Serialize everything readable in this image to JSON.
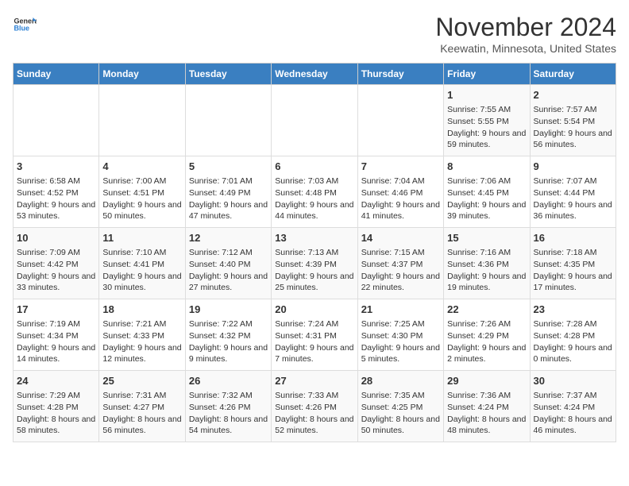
{
  "header": {
    "logo": {
      "line1": "General",
      "line2": "Blue"
    },
    "title": "November 2024",
    "subtitle": "Keewatin, Minnesota, United States"
  },
  "weekdays": [
    "Sunday",
    "Monday",
    "Tuesday",
    "Wednesday",
    "Thursday",
    "Friday",
    "Saturday"
  ],
  "weeks": [
    [
      {
        "day": "",
        "info": ""
      },
      {
        "day": "",
        "info": ""
      },
      {
        "day": "",
        "info": ""
      },
      {
        "day": "",
        "info": ""
      },
      {
        "day": "",
        "info": ""
      },
      {
        "day": "1",
        "info": "Sunrise: 7:55 AM\nSunset: 5:55 PM\nDaylight: 9 hours and 59 minutes."
      },
      {
        "day": "2",
        "info": "Sunrise: 7:57 AM\nSunset: 5:54 PM\nDaylight: 9 hours and 56 minutes."
      }
    ],
    [
      {
        "day": "3",
        "info": "Sunrise: 6:58 AM\nSunset: 4:52 PM\nDaylight: 9 hours and 53 minutes."
      },
      {
        "day": "4",
        "info": "Sunrise: 7:00 AM\nSunset: 4:51 PM\nDaylight: 9 hours and 50 minutes."
      },
      {
        "day": "5",
        "info": "Sunrise: 7:01 AM\nSunset: 4:49 PM\nDaylight: 9 hours and 47 minutes."
      },
      {
        "day": "6",
        "info": "Sunrise: 7:03 AM\nSunset: 4:48 PM\nDaylight: 9 hours and 44 minutes."
      },
      {
        "day": "7",
        "info": "Sunrise: 7:04 AM\nSunset: 4:46 PM\nDaylight: 9 hours and 41 minutes."
      },
      {
        "day": "8",
        "info": "Sunrise: 7:06 AM\nSunset: 4:45 PM\nDaylight: 9 hours and 39 minutes."
      },
      {
        "day": "9",
        "info": "Sunrise: 7:07 AM\nSunset: 4:44 PM\nDaylight: 9 hours and 36 minutes."
      }
    ],
    [
      {
        "day": "10",
        "info": "Sunrise: 7:09 AM\nSunset: 4:42 PM\nDaylight: 9 hours and 33 minutes."
      },
      {
        "day": "11",
        "info": "Sunrise: 7:10 AM\nSunset: 4:41 PM\nDaylight: 9 hours and 30 minutes."
      },
      {
        "day": "12",
        "info": "Sunrise: 7:12 AM\nSunset: 4:40 PM\nDaylight: 9 hours and 27 minutes."
      },
      {
        "day": "13",
        "info": "Sunrise: 7:13 AM\nSunset: 4:39 PM\nDaylight: 9 hours and 25 minutes."
      },
      {
        "day": "14",
        "info": "Sunrise: 7:15 AM\nSunset: 4:37 PM\nDaylight: 9 hours and 22 minutes."
      },
      {
        "day": "15",
        "info": "Sunrise: 7:16 AM\nSunset: 4:36 PM\nDaylight: 9 hours and 19 minutes."
      },
      {
        "day": "16",
        "info": "Sunrise: 7:18 AM\nSunset: 4:35 PM\nDaylight: 9 hours and 17 minutes."
      }
    ],
    [
      {
        "day": "17",
        "info": "Sunrise: 7:19 AM\nSunset: 4:34 PM\nDaylight: 9 hours and 14 minutes."
      },
      {
        "day": "18",
        "info": "Sunrise: 7:21 AM\nSunset: 4:33 PM\nDaylight: 9 hours and 12 minutes."
      },
      {
        "day": "19",
        "info": "Sunrise: 7:22 AM\nSunset: 4:32 PM\nDaylight: 9 hours and 9 minutes."
      },
      {
        "day": "20",
        "info": "Sunrise: 7:24 AM\nSunset: 4:31 PM\nDaylight: 9 hours and 7 minutes."
      },
      {
        "day": "21",
        "info": "Sunrise: 7:25 AM\nSunset: 4:30 PM\nDaylight: 9 hours and 5 minutes."
      },
      {
        "day": "22",
        "info": "Sunrise: 7:26 AM\nSunset: 4:29 PM\nDaylight: 9 hours and 2 minutes."
      },
      {
        "day": "23",
        "info": "Sunrise: 7:28 AM\nSunset: 4:28 PM\nDaylight: 9 hours and 0 minutes."
      }
    ],
    [
      {
        "day": "24",
        "info": "Sunrise: 7:29 AM\nSunset: 4:28 PM\nDaylight: 8 hours and 58 minutes."
      },
      {
        "day": "25",
        "info": "Sunrise: 7:31 AM\nSunset: 4:27 PM\nDaylight: 8 hours and 56 minutes."
      },
      {
        "day": "26",
        "info": "Sunrise: 7:32 AM\nSunset: 4:26 PM\nDaylight: 8 hours and 54 minutes."
      },
      {
        "day": "27",
        "info": "Sunrise: 7:33 AM\nSunset: 4:26 PM\nDaylight: 8 hours and 52 minutes."
      },
      {
        "day": "28",
        "info": "Sunrise: 7:35 AM\nSunset: 4:25 PM\nDaylight: 8 hours and 50 minutes."
      },
      {
        "day": "29",
        "info": "Sunrise: 7:36 AM\nSunset: 4:24 PM\nDaylight: 8 hours and 48 minutes."
      },
      {
        "day": "30",
        "info": "Sunrise: 7:37 AM\nSunset: 4:24 PM\nDaylight: 8 hours and 46 minutes."
      }
    ]
  ]
}
